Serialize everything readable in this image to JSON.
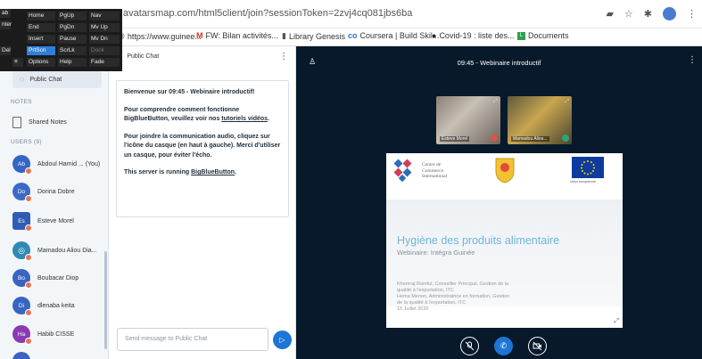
{
  "browser": {
    "url": "avatarsmap.com/html5client/join?sessionToken=2zvj4cq081jbs6ba",
    "bookmarks": [
      {
        "label": "https://www.guinee...",
        "icon": "globe-icon"
      },
      {
        "label": "FW: Bilan activités...",
        "icon": "gmail-icon",
        "glyph": "M"
      },
      {
        "label": "Library Genesis",
        "icon": "library-icon"
      },
      {
        "label": "Coursera | Build Skil...",
        "icon": "coursera-icon",
        "glyph": "co"
      },
      {
        "label": "Covid-19 : liste des...",
        "icon": "github-icon"
      },
      {
        "label": "Documents",
        "icon": "documents-icon"
      }
    ]
  },
  "keyboard": {
    "keys": [
      "Home",
      "PgUp",
      "Nav",
      "End",
      "PgDn",
      "Mv Up",
      "Insert",
      "Pause",
      "Mv Dn",
      "PrtScn",
      "ScrLk",
      "Dock",
      "Options",
      "Help",
      "Fade",
      "Del"
    ],
    "partial": [
      "ab",
      "nter"
    ]
  },
  "userlist": {
    "public_chat_label": "Public Chat",
    "notes_section": "NOTES",
    "shared_notes_label": "Shared Notes",
    "users_section": "USERS (9)",
    "users": [
      {
        "initials": "Ab",
        "name": "Abdoul Hamid ... (You)",
        "color": "#3366c4"
      },
      {
        "initials": "Do",
        "name": "Dorina Dobre",
        "color": "#3c6bc6"
      },
      {
        "initials": "Es",
        "name": "Esteve Morel",
        "color": "#2f5db5"
      },
      {
        "initials": "",
        "name": "Mamadou Aliou Dia...",
        "color": "#2e89b4"
      },
      {
        "initials": "Bo",
        "name": "Boubacar Diop",
        "color": "#3a63c2"
      },
      {
        "initials": "Di",
        "name": "dlenaba keita",
        "color": "#3766c0"
      },
      {
        "initials": "Ha",
        "name": "Habib CISSE",
        "color": "#8a3ab3"
      }
    ]
  },
  "chat": {
    "title": "Public Chat",
    "welcome_heading": "Bienvenue sur 09:45 - Webinaire introductif!",
    "para1_a": "Pour comprendre comment fonctionne BigBlueButton, veuillez voir nos ",
    "para1_link": "tutoriels vidéos",
    "para1_b": ".",
    "para2": "Pour joindre la communication audio, cliquez sur l'icône du casque (en haut à gauche). Merci d'utiliser un casque, pour éviter l'écho.",
    "para3_a": "This server is running ",
    "para3_link": "BigBlueButton",
    "para3_b": ".",
    "input_placeholder": "Send message to Public Chat"
  },
  "main": {
    "title": "09:45 - Webinaire introductif",
    "cameras": [
      {
        "name": "Esteve Morel"
      },
      {
        "name": "Mamadou Aliou..."
      }
    ],
    "slide": {
      "org_line1": "Centre de",
      "org_line2": "Commerce",
      "org_line3": "International",
      "eu_caption": "Union européenne",
      "title": "Hygiène des produits alimentaire",
      "subtitle": "Webinaire: Intégra Guinée",
      "names": [
        "Khemraj Ramful, Conseiller Principal, Gestion de la",
        "qualité à l'exportation, ITC",
        "Hema Menon, Administratrice en formation, Gestion",
        "de la qualité à l'exportation, ITC",
        "15 Juillet 2020"
      ]
    }
  }
}
